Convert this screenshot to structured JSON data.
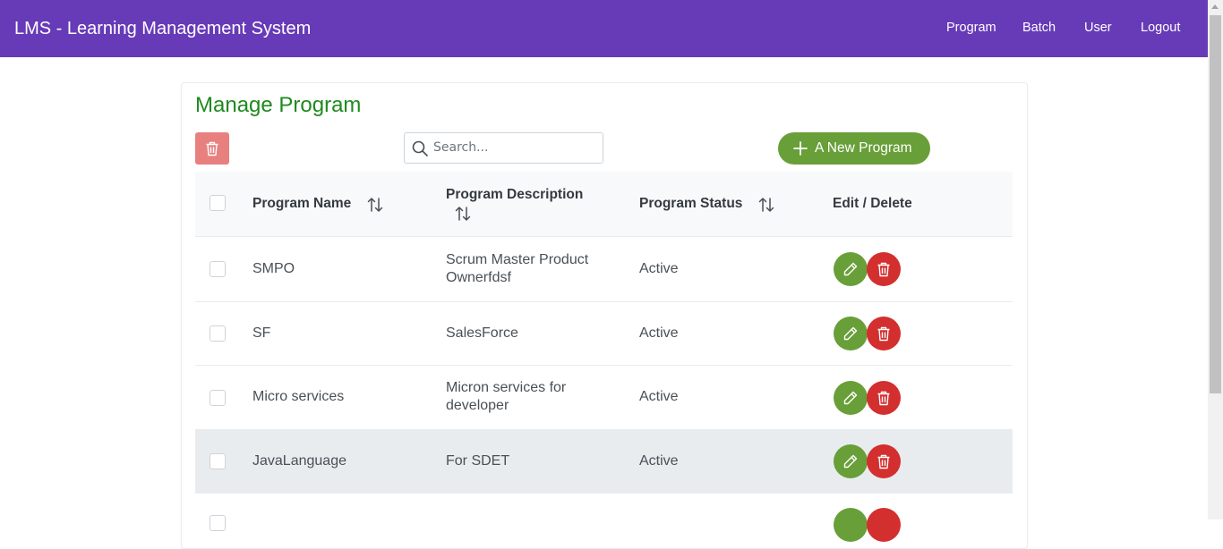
{
  "header": {
    "title": "LMS - Learning Management System",
    "nav": [
      "Program",
      "Batch",
      "User",
      "Logout"
    ]
  },
  "page": {
    "title": "Manage Program",
    "search_placeholder": "Search...",
    "new_button_label": "A New Program"
  },
  "table": {
    "columns": [
      "Program Name",
      "Program Description",
      "Program Status",
      "Edit / Delete"
    ],
    "rows": [
      {
        "name": "SMPO",
        "desc_line1": "Scrum Master Product",
        "desc_line2": "Ownerfdsf",
        "status": "Active"
      },
      {
        "name": "SF",
        "desc_line1": "SalesForce",
        "desc_line2": "",
        "status": "Active"
      },
      {
        "name": "Micro services",
        "desc_line1": "Micron services for",
        "desc_line2": "developer",
        "status": "Active"
      },
      {
        "name": "JavaLanguage",
        "desc_line1": "For SDET",
        "desc_line2": "",
        "status": "Active"
      }
    ]
  },
  "colors": {
    "header_bg": "#673ab7",
    "title_green": "#1e8a1e",
    "button_green": "#689f38",
    "delete_red": "#d32f2f",
    "bulk_delete_red": "#e88080"
  },
  "icons": [
    "trash-icon",
    "search-icon",
    "plus-icon",
    "sort-icon",
    "pencil-icon"
  ]
}
